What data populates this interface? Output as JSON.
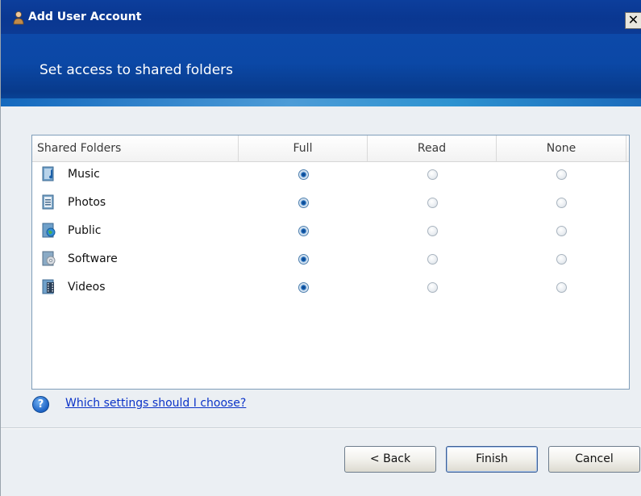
{
  "window": {
    "title": "Add User Account",
    "close_glyph": "✕"
  },
  "banner": {
    "title": "Set access to shared folders"
  },
  "list": {
    "columns": [
      "Shared Folders",
      "Full",
      "Read",
      "None"
    ],
    "rows": [
      {
        "name": "Music",
        "icon": "music-folder-icon",
        "access": "Full"
      },
      {
        "name": "Photos",
        "icon": "photos-folder-icon",
        "access": "Full"
      },
      {
        "name": "Public",
        "icon": "public-folder-icon",
        "access": "Full"
      },
      {
        "name": "Software",
        "icon": "software-folder-icon",
        "access": "Full"
      },
      {
        "name": "Videos",
        "icon": "videos-folder-icon",
        "access": "Full"
      }
    ]
  },
  "help": {
    "icon_glyph": "?",
    "link_text": "Which settings should I choose?"
  },
  "buttons": {
    "back_label": "< Back",
    "finish_label": "Finish",
    "cancel_label": "Cancel"
  },
  "colors": {
    "titlebar": "#0a3791",
    "banner": "#0b48a6",
    "link": "#0b33c8",
    "dialog_bg": "#ebeff3"
  }
}
